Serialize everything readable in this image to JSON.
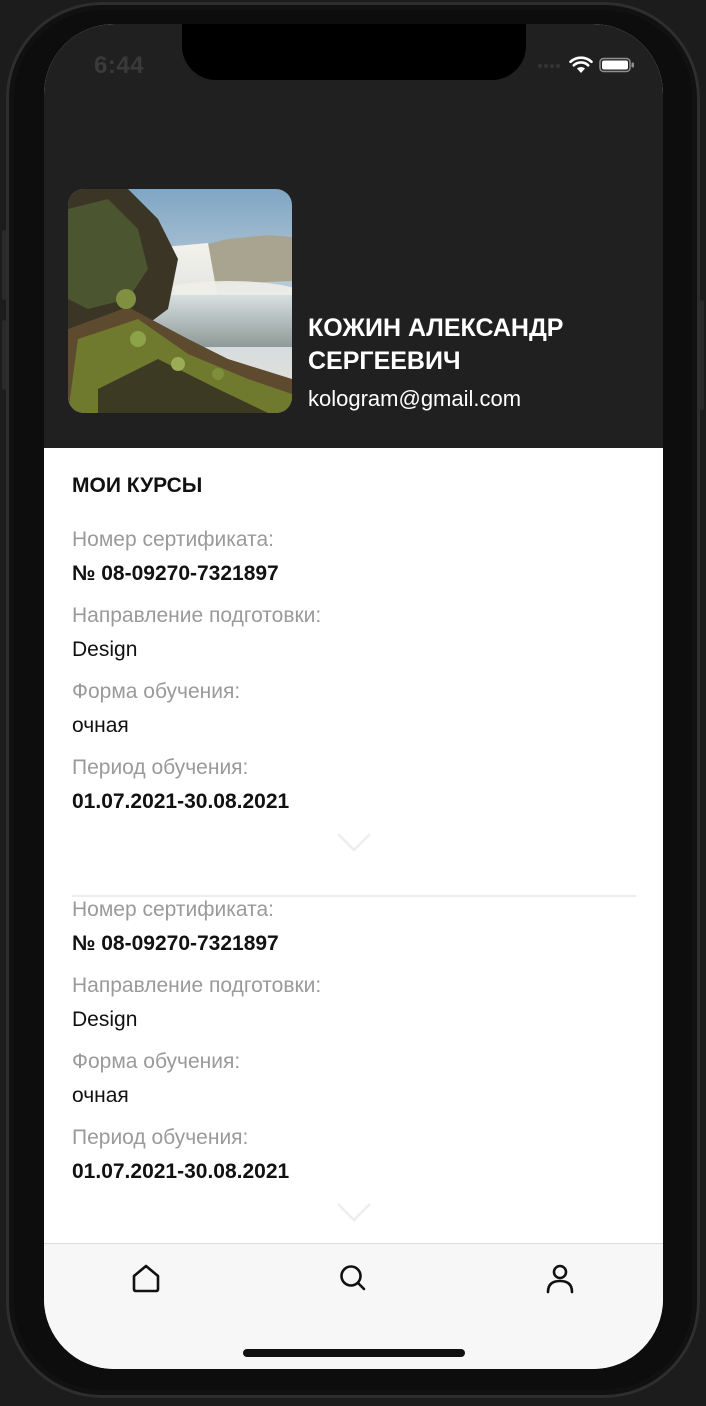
{
  "status_bar": {
    "time": "6:44"
  },
  "profile": {
    "name": "КОЖИН АЛЕКСАНДР СЕРГЕЕВИЧ",
    "email": "kologram@gmail.com",
    "avatar_subject": "waterfall landscape photo"
  },
  "section": {
    "title": "МОИ КУРСЫ"
  },
  "courses": [
    {
      "cert_label": "Номер сертификата:",
      "cert_value": "№ 08-09270-7321897",
      "direction_label": "Направление подготовки:",
      "direction_value": "Design",
      "form_label": "Форма обучения:",
      "form_value": "очная",
      "period_label": "Период обучения:",
      "period_value": "01.07.2021-30.08.2021"
    },
    {
      "cert_label": "Номер сертификата:",
      "cert_value": "№ 08-09270-7321897",
      "direction_label": "Направление подготовки:",
      "direction_value": "Design",
      "form_label": "Форма обучения:",
      "form_value": "очная",
      "period_label": "Период обучения:",
      "period_value": "01.07.2021-30.08.2021"
    }
  ],
  "tabbar": {
    "items": [
      {
        "icon": "home-icon"
      },
      {
        "icon": "search-icon"
      },
      {
        "icon": "profile-icon"
      }
    ]
  },
  "colors": {
    "header_bg": "#202020",
    "label_gray": "#9a9a9a",
    "text_dark": "#111111",
    "tabbar_bg": "#f7f7f7"
  }
}
